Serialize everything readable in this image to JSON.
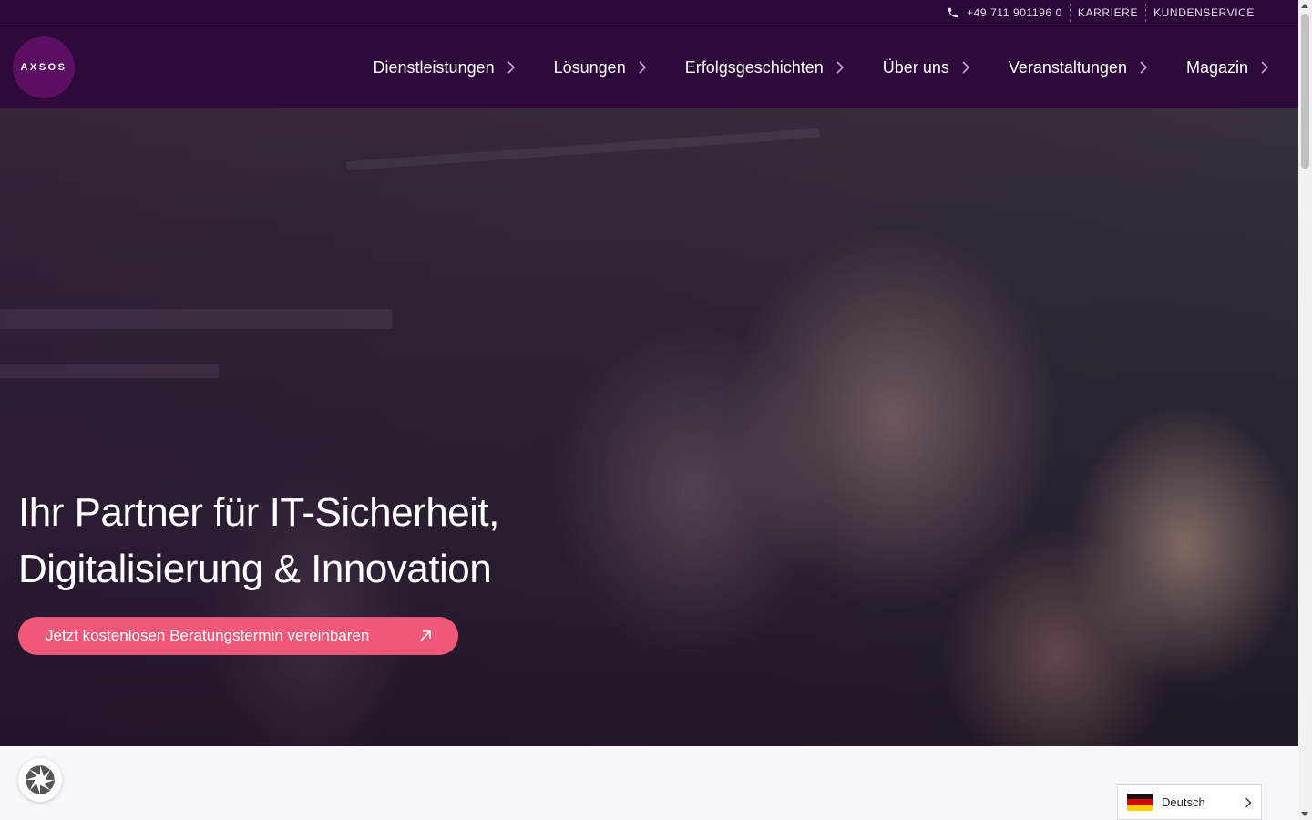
{
  "topbar": {
    "phone": "+49 711 901196 0",
    "links": [
      "KARRIERE",
      "KUNDENSERVICE"
    ]
  },
  "logo": {
    "text": "AXSOS"
  },
  "nav": {
    "items": [
      {
        "label": "Dienstleistungen"
      },
      {
        "label": "Lösungen"
      },
      {
        "label": "Erfolgsgeschichten"
      },
      {
        "label": "Über uns"
      },
      {
        "label": "Veranstaltungen"
      },
      {
        "label": "Magazin"
      }
    ]
  },
  "hero": {
    "title_line1": "Ihr Partner für IT-Sicherheit,",
    "title_line2": "Digitalisierung & Innovation",
    "cta_label": "Jetzt kostenlosen Beratungstermin vereinbaren"
  },
  "language": {
    "selected": "Deutsch",
    "flag": "de-flag-icon"
  },
  "colors": {
    "header_bg": "#2d0a3a",
    "accent": "#f0587a",
    "logo_bg": "#5b0f63"
  }
}
